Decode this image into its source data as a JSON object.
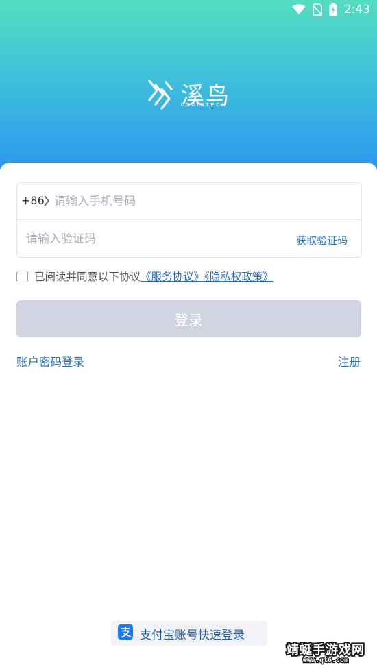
{
  "status_bar": {
    "time": "2:43",
    "icons": [
      "wifi-icon",
      "no-sim-icon",
      "battery-charging-icon"
    ]
  },
  "brand": {
    "name": "溪鸟",
    "subtitle": "LOGISTECH"
  },
  "login_form": {
    "country_code": "+86",
    "phone_placeholder": "请输入手机号码",
    "code_placeholder": "请输入验证码",
    "get_code_label": "获取验证码",
    "agreement_text": "已阅读并同意以下协议",
    "agreement_links": "《服务协议》《隐私权政策》",
    "agreement_checked": false,
    "login_button": "登录"
  },
  "links": {
    "account_login": "账户密码登录",
    "register": "注册"
  },
  "alipay": {
    "label": "支付宝账号快速登录"
  },
  "watermark": {
    "title": "靖蜓手游戏网",
    "url": "www.qt6.com"
  },
  "colors": {
    "header_gradient_top": "#55dcc0",
    "header_gradient_bottom": "#2a93ee",
    "link_blue": "#2c6fb7",
    "login_button_disabled": "#d3d4e1",
    "alipay_blue": "#1677ff"
  }
}
